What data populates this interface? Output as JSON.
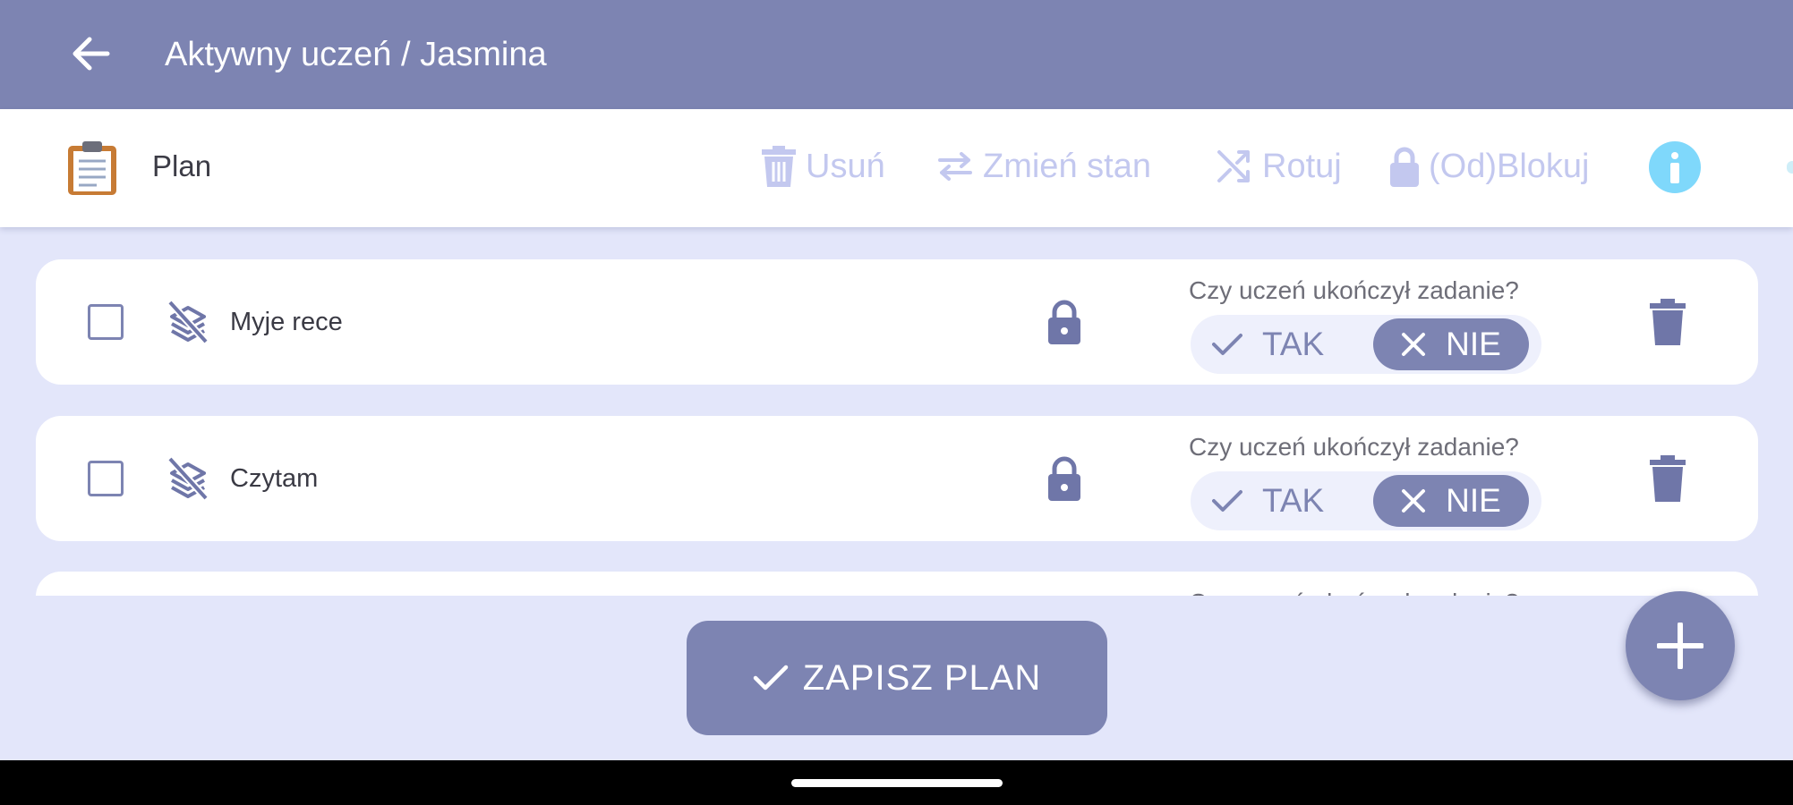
{
  "app": {
    "title": "Aktywny uczeń / Jasmina",
    "back_icon": "arrow-left-icon",
    "colors": {
      "primary": "#7d84b2",
      "background": "#e3e6fa",
      "toolbar_disabled": "#c3c8ef",
      "info": "#7fd8fb"
    }
  },
  "toolbar": {
    "plan_icon": "clipboard-icon",
    "plan_label": "Plan",
    "delete_label": "Usuń",
    "change_state_label": "Zmień stan",
    "rotate_label": "Rotuj",
    "lock_label": "(Od)Blokuj",
    "info_icon": "info-icon"
  },
  "tasks": [
    {
      "name": "Myje rece",
      "checked": false,
      "locked": true,
      "question": "Czy uczeń ukończył zadanie?",
      "yes_label": "TAK",
      "no_label": "NIE",
      "selected": "NIE"
    },
    {
      "name": "Czytam",
      "checked": false,
      "locked": true,
      "question": "Czy uczeń ukończył zadanie?",
      "yes_label": "TAK",
      "no_label": "NIE",
      "selected": "NIE"
    },
    {
      "name": "",
      "question": "Czy uczeń ukończył zadanie?"
    }
  ],
  "footer": {
    "save_label": "ZAPISZ PLAN",
    "add_icon": "plus-icon"
  }
}
